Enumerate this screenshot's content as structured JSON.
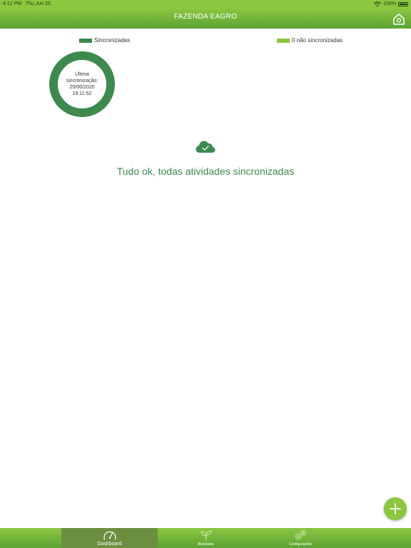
{
  "status_bar": {
    "time": "4:12 PM",
    "date": "Thu Jun 25",
    "battery": "100%"
  },
  "header": {
    "title": "FAZENDA EAGRO",
    "home_icon": "home-icon"
  },
  "legend": {
    "synced_label": "Sincronizadas",
    "unsynced_label": "0 não sincronizadas",
    "synced_color": "#3d8a4e",
    "unsynced_color": "#8dc63f"
  },
  "donut": {
    "line1": "Última",
    "line2": "sincronização:",
    "date": "25/06/2020",
    "time": "16:11:52",
    "synced_fraction": 1.0,
    "ring_color": "#3d8a4e"
  },
  "message": {
    "text": "Tudo ok, todas atividades sincronizadas",
    "icon": "cloud-check-icon"
  },
  "fab": {
    "icon": "plus-icon"
  },
  "tabs": [
    {
      "label": "Dashboard",
      "icon": "speedometer-icon",
      "active": true
    },
    {
      "label": "Atividades",
      "icon": "plant-icon",
      "active": false
    },
    {
      "label": "Configurações",
      "icon": "gears-icon",
      "active": false
    }
  ],
  "colors": {
    "accent": "#8dc63f",
    "dark_green": "#3d8a4e"
  }
}
